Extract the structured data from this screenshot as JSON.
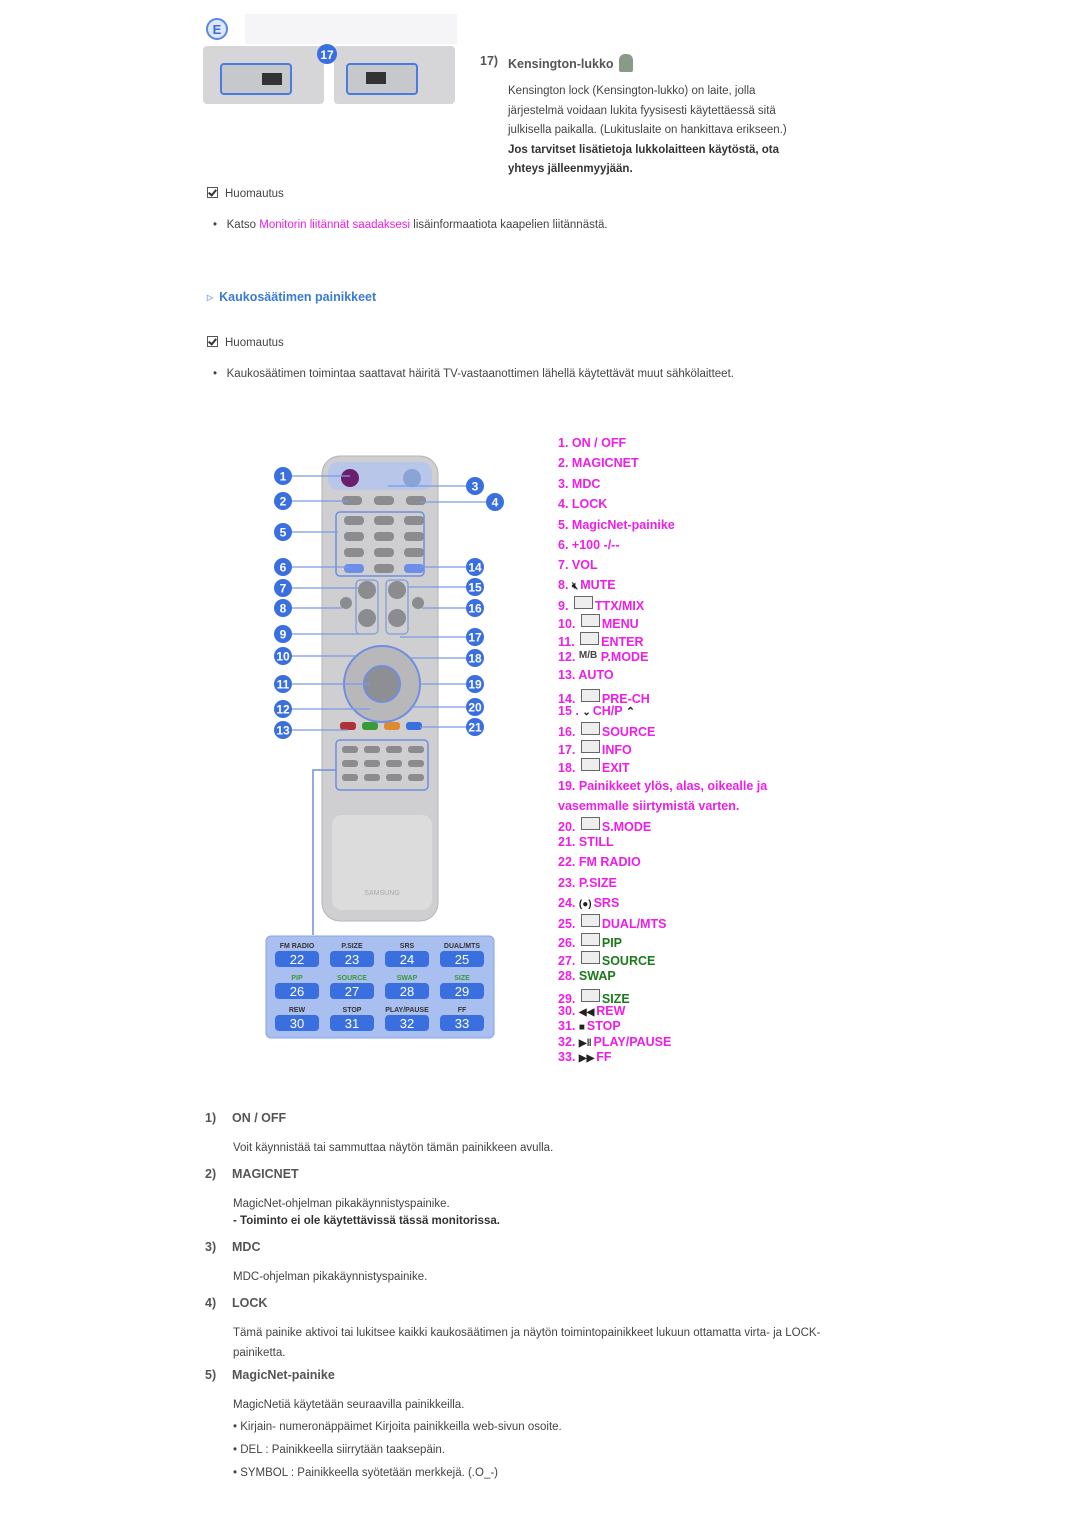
{
  "top": {
    "panel_badge": "E",
    "panel_callout": "17",
    "item_number": "17)",
    "item_title": "Kensington-lukko",
    "paragraph": "Kensington lock (Kensington-lukko) on laite, jolla järjestelmä voidaan lukita fyysisesti käytettäessä sitä julkisella paikalla. (Lukituslaite on hankittava erikseen.)",
    "bold_note": "Jos tarvitset lisätietoja lukkolaitteen käytöstä, ota yhteys jälleenmyyjään."
  },
  "note1": {
    "label": "Huomautus",
    "prefix": "Katso ",
    "link": "Monitorin liitännät saadaksesi",
    "suffix": " lisäinformaatiota kaapelien liitännästä."
  },
  "section": {
    "title": "Kaukosäätimen painikkeet"
  },
  "note2": {
    "label": "Huomautus",
    "text": "Kaukosäätimen toimintaa saattavat häiritä TV-vastaanottimen lähellä käytettävät muut sähkölaitteet."
  },
  "colors": {
    "accent": "#ee1ee6",
    "green": "#1b7a1b",
    "link_blue": "#3a7bd5",
    "callout_blue": "#3a6fe0"
  },
  "remote": {
    "callouts": [
      "1",
      "2",
      "3",
      "4",
      "5",
      "6",
      "7",
      "8",
      "9",
      "10",
      "11",
      "12",
      "13",
      "14",
      "15",
      "16",
      "17",
      "18",
      "19",
      "20",
      "21"
    ],
    "brand": "SAMSUNG",
    "keypad": [
      {
        "label": "FM RADIO",
        "num": "22",
        "green": false
      },
      {
        "label": "P.SIZE",
        "num": "23",
        "green": false
      },
      {
        "label": "SRS",
        "num": "24",
        "green": false
      },
      {
        "label": "DUAL/MTS",
        "num": "25",
        "green": false
      },
      {
        "label": "PIP",
        "num": "26",
        "green": true
      },
      {
        "label": "SOURCE",
        "num": "27",
        "green": true
      },
      {
        "label": "SWAP",
        "num": "28",
        "green": true
      },
      {
        "label": "SIZE",
        "num": "29",
        "green": true
      },
      {
        "label": "REW",
        "num": "30",
        "green": false
      },
      {
        "label": "STOP",
        "num": "31",
        "green": false
      },
      {
        "label": "PLAY/PAUSE",
        "num": "32",
        "green": false
      },
      {
        "label": "FF",
        "num": "33",
        "green": false
      }
    ]
  },
  "legend": [
    {
      "num": "1.",
      "label": "ON / OFF"
    },
    {
      "num": "2.",
      "label": "MAGICNET"
    },
    {
      "num": "3.",
      "label": "MDC"
    },
    {
      "num": "4.",
      "label": "LOCK"
    },
    {
      "num": "5.",
      "label": "MagicNet-painike"
    },
    {
      "num": "6.",
      "label": "+100 -/--"
    },
    {
      "num": "7.",
      "label": "VOL"
    },
    {
      "num": "8.",
      "label": "MUTE",
      "icon": "mute-icon"
    },
    {
      "num": "9.",
      "label": "TTX/MIX",
      "icon": "teletext-icon"
    },
    {
      "num": "10.",
      "label": "MENU",
      "icon": "menu-icon"
    },
    {
      "num": "11.",
      "label": "ENTER",
      "icon": "enter-icon"
    },
    {
      "num": "12.",
      "label": "P.MODE",
      "icon": "mb-icon",
      "icon_text": "M/B"
    },
    {
      "num": "13.",
      "label": "AUTO"
    },
    {
      "num": "14.",
      "label": "PRE-CH",
      "icon": "pre-ch-icon"
    },
    {
      "num": "15 .",
      "label": "CH/P",
      "icon": "chevron-down-icon",
      "icon_after": "chevron-up-icon"
    },
    {
      "num": "16.",
      "label": "SOURCE",
      "icon": "source-icon"
    },
    {
      "num": "17.",
      "label": "INFO",
      "icon": "info-icon"
    },
    {
      "num": "18.",
      "label": "EXIT",
      "icon": "exit-icon"
    },
    {
      "num": "19.",
      "label": "Painikkeet ylös, alas, oikealle ja vasemmalle siirtymistä varten."
    },
    {
      "num": "20.",
      "label": "S.MODE",
      "icon": "s-mode-icon"
    },
    {
      "num": "21.",
      "label": "STILL"
    },
    {
      "num": "22.",
      "label": "FM RADIO"
    },
    {
      "num": "23.",
      "label": "P.SIZE"
    },
    {
      "num": "24.",
      "label": "SRS",
      "icon": "srs-icon"
    },
    {
      "num": "25.",
      "label": "DUAL/MTS",
      "icon": "dual-icon"
    },
    {
      "num": "26.",
      "label": "PIP",
      "icon": "pip-icon",
      "green": true
    },
    {
      "num": "27.",
      "label": "SOURCE",
      "icon": "source-icon",
      "green": true
    },
    {
      "num": "28.",
      "label": "SWAP",
      "green": true
    },
    {
      "num": "29.",
      "label": "SIZE",
      "icon": "size-icon",
      "green": true
    },
    {
      "num": "30.",
      "label": "REW",
      "icon": "rewind-icon"
    },
    {
      "num": "31.",
      "label": "STOP",
      "icon": "stop-icon"
    },
    {
      "num": "32.",
      "label": "PLAY/PAUSE",
      "icon": "play-pause-icon"
    },
    {
      "num": "33.",
      "label": "FF",
      "icon": "fast-forward-icon"
    }
  ],
  "details": [
    {
      "num": "1)",
      "title": "ON / OFF",
      "lines": [
        "Voit käynnistää tai sammuttaa näytön tämän painikkeen avulla."
      ]
    },
    {
      "num": "2)",
      "title": "MAGICNET",
      "lines": [
        "MagicNet-ohjelman pikakäynnistyspainike."
      ],
      "bold": "- Toiminto ei ole käytettävissä tässä monitorissa."
    },
    {
      "num": "3)",
      "title": "MDC",
      "lines": [
        "MDC-ohjelman pikakäynnistyspainike."
      ]
    },
    {
      "num": "4)",
      "title": "LOCK",
      "lines": [
        "Tämä painike aktivoi tai lukitsee kaikki kaukosäätimen ja näytön toimintopainikkeet lukuun ottamatta virta- ja LOCK-painiketta."
      ]
    },
    {
      "num": "5)",
      "title": "MagicNet-painike",
      "lines": [
        "MagicNetiä käytetään seuraavilla painikkeilla.",
        "• Kirjain- numeronäppäimet Kirjoita painikkeilla web-sivun osoite.",
        "• DEL : Painikkeella siirrytään taaksepäin.",
        "• SYMBOL : Painikkeella syötetään merkkejä. (.O_-)"
      ]
    }
  ]
}
